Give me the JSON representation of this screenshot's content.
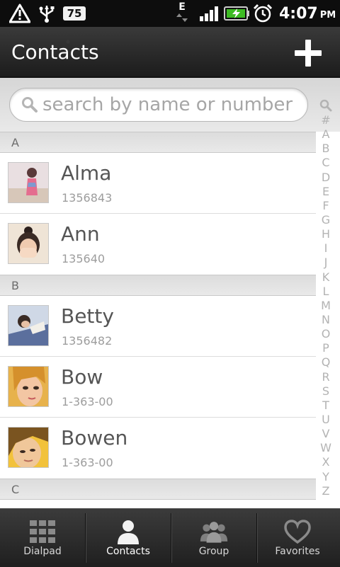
{
  "status_bar": {
    "battery_badge": "75",
    "network_type": "E",
    "time": "4:07",
    "ampm": "PM"
  },
  "header": {
    "title": "Contacts"
  },
  "search": {
    "placeholder": "search by name or number"
  },
  "contacts": {
    "sections": [
      {
        "letter": "A",
        "items": [
          {
            "name": "Alma",
            "number": "1356843"
          },
          {
            "name": "Ann",
            "number": "135640"
          }
        ]
      },
      {
        "letter": "B",
        "items": [
          {
            "name": "Betty",
            "number": "1356482"
          },
          {
            "name": "Bow",
            "number": "1-363-00"
          },
          {
            "name": "Bowen",
            "number": "1-363-00"
          }
        ]
      },
      {
        "letter": "C",
        "items": []
      }
    ]
  },
  "alpha_index": [
    "#",
    "A",
    "B",
    "C",
    "D",
    "E",
    "F",
    "G",
    "H",
    "I",
    "J",
    "K",
    "L",
    "M",
    "N",
    "O",
    "P",
    "Q",
    "R",
    "S",
    "T",
    "U",
    "V",
    "W",
    "X",
    "Y",
    "Z"
  ],
  "tabs": [
    {
      "label": "Dialpad",
      "icon": "dialpad-icon"
    },
    {
      "label": "Contacts",
      "icon": "person-icon",
      "active": true
    },
    {
      "label": "Group",
      "icon": "group-icon"
    },
    {
      "label": "Favorites",
      "icon": "heart-icon"
    }
  ],
  "colors": {
    "status_bar_bg": "#0d0d0d",
    "title_bar_bg": "#2b2b2b",
    "section_bg": "#e3e3e3",
    "name_text": "#555555",
    "number_text": "#9d9d9d"
  }
}
